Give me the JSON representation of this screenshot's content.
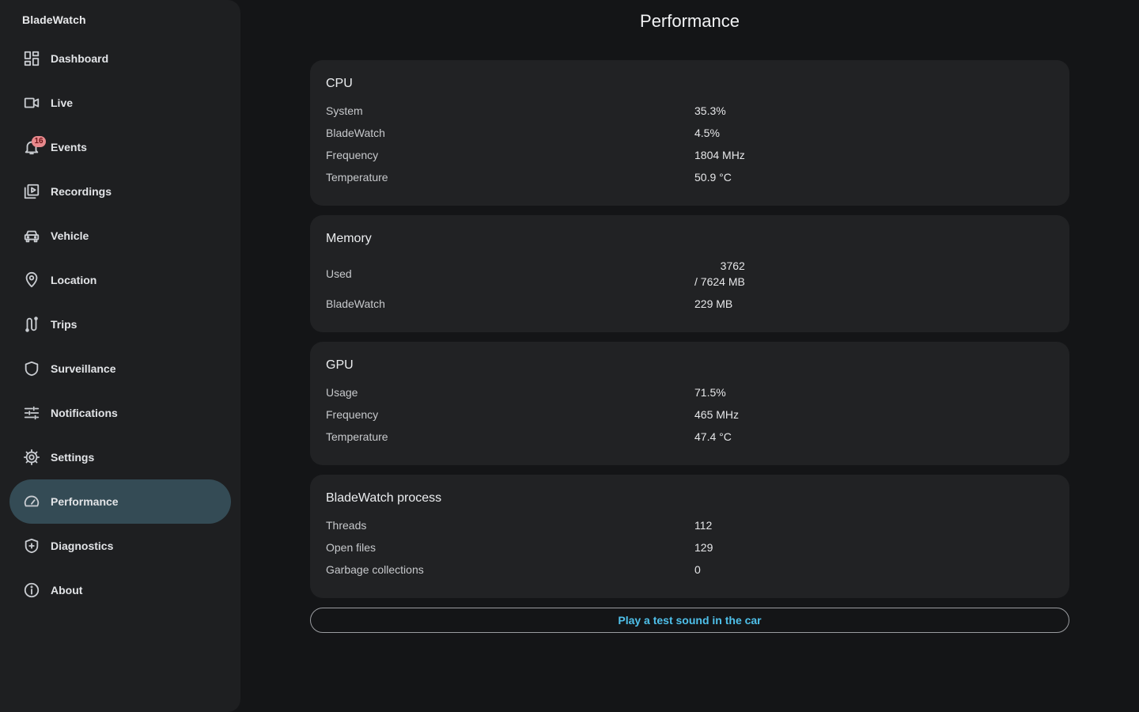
{
  "app": {
    "name": "BladeWatch"
  },
  "page": {
    "title": "Performance"
  },
  "sidebar": {
    "items": [
      {
        "label": "Dashboard",
        "icon": "dashboard-icon"
      },
      {
        "label": "Live",
        "icon": "video-camera-icon"
      },
      {
        "label": "Events",
        "icon": "bell-icon",
        "badge": "16"
      },
      {
        "label": "Recordings",
        "icon": "video-library-icon"
      },
      {
        "label": "Vehicle",
        "icon": "car-icon"
      },
      {
        "label": "Location",
        "icon": "location-pin-icon"
      },
      {
        "label": "Trips",
        "icon": "route-icon"
      },
      {
        "label": "Surveillance",
        "icon": "shield-icon"
      },
      {
        "label": "Notifications",
        "icon": "sliders-icon"
      },
      {
        "label": "Settings",
        "icon": "gear-icon"
      },
      {
        "label": "Performance",
        "icon": "speedometer-icon",
        "active": true
      },
      {
        "label": "Diagnostics",
        "icon": "shield-plus-icon"
      },
      {
        "label": "About",
        "icon": "info-icon"
      }
    ]
  },
  "cpu": {
    "title": "CPU",
    "rows": [
      {
        "label": "System",
        "value": "35.3%"
      },
      {
        "label": "BladeWatch",
        "value": "4.5%"
      },
      {
        "label": "Frequency",
        "value": "1804 MHz"
      },
      {
        "label": "Temperature",
        "value": "50.9 °C"
      }
    ]
  },
  "memory": {
    "title": "Memory",
    "used_label": "Used",
    "used_value": "3762",
    "total_value": "/ 7624 MB",
    "bladewatch_label": "BladeWatch",
    "bladewatch_value": "229 MB"
  },
  "gpu": {
    "title": "GPU",
    "rows": [
      {
        "label": "Usage",
        "value": "71.5%"
      },
      {
        "label": "Frequency",
        "value": "465 MHz"
      },
      {
        "label": "Temperature",
        "value": "47.4 °C"
      }
    ]
  },
  "process": {
    "title": "BladeWatch process",
    "rows": [
      {
        "label": "Threads",
        "value": "112"
      },
      {
        "label": "Open files",
        "value": "129"
      },
      {
        "label": "Garbage collections",
        "value": "0"
      }
    ]
  },
  "actions": {
    "test_sound": "Play a test sound in the car"
  },
  "colors": {
    "accent": "#4fc0ea",
    "active_nav": "#344b55",
    "badge": "#e8898d"
  }
}
